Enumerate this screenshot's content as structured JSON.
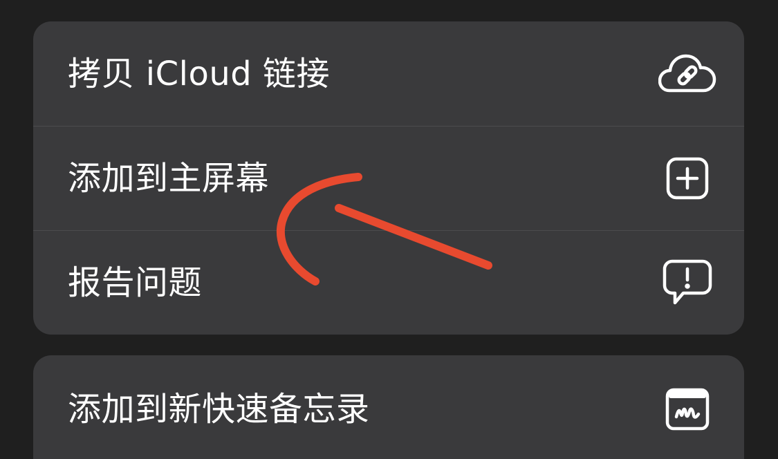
{
  "menu": {
    "group1": [
      {
        "label": "拷贝 iCloud 链接",
        "icon": "icloud-link-icon"
      },
      {
        "label": "添加到主屏幕",
        "icon": "add-square-icon"
      },
      {
        "label": "报告问题",
        "icon": "exclamation-bubble-icon"
      }
    ],
    "group2": [
      {
        "label": "添加到新快速备忘录",
        "icon": "quick-note-icon"
      }
    ]
  },
  "colors": {
    "background": "#1f1f1f",
    "panel": "#3a3a3c",
    "separator": "#4c4c4e",
    "text": "#ffffff",
    "annotation": "#e84a2f"
  }
}
